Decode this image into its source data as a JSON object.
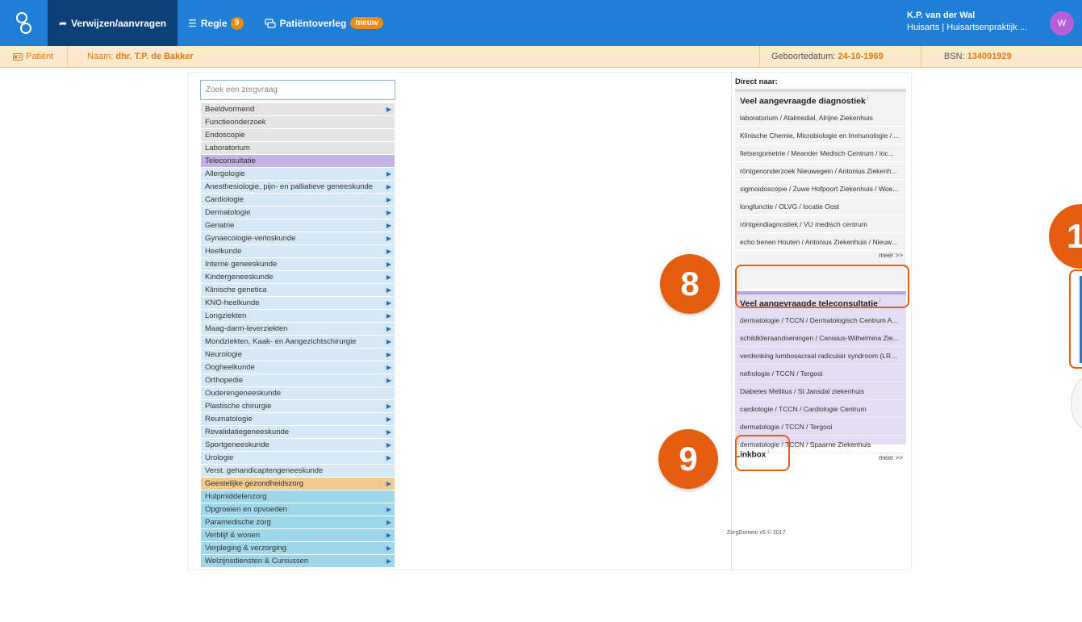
{
  "nav": {
    "items": [
      {
        "label": "Verwijzen/aanvragen",
        "icon": "share-arrow-icon"
      },
      {
        "label": "Regie",
        "icon": "list-icon",
        "badge": "9"
      },
      {
        "label": "Patiëntoverleg",
        "icon": "chat-icon",
        "badge": "nieuw"
      }
    ]
  },
  "user": {
    "name": "K.P. van der Wal",
    "role": "Huisarts | Huisartsenpraktijk ...",
    "avatar_initial": "W"
  },
  "patient": {
    "tab_label": "Patiënt",
    "name_label": "Naam:",
    "name": "dhr. T.P. de Bakker",
    "dob_label": "Geboortedatum:",
    "dob": "24-10-1969",
    "bsn_label": "BSN:",
    "bsn": "134091929"
  },
  "search": {
    "placeholder": "Zoek een zorgvraag"
  },
  "categories": [
    {
      "label": "Beeldvormend",
      "color": "gray",
      "arrow": true
    },
    {
      "label": "Functieonderzoek",
      "color": "gray",
      "arrow": false
    },
    {
      "label": "Endoscopie",
      "color": "gray",
      "arrow": false
    },
    {
      "label": "Laboratorium",
      "color": "gray",
      "arrow": false
    },
    {
      "label": "Teleconsultatie",
      "color": "purple",
      "arrow": false
    },
    {
      "label": "Allergologie",
      "color": "blue",
      "arrow": true
    },
    {
      "label": "Anesthesiologie, pijn- en palliatieve geneeskunde",
      "color": "blue",
      "arrow": true
    },
    {
      "label": "Cardiologie",
      "color": "blue",
      "arrow": true
    },
    {
      "label": "Dermatologie",
      "color": "blue",
      "arrow": true
    },
    {
      "label": "Geriatrie",
      "color": "blue",
      "arrow": true
    },
    {
      "label": "Gynaecologie-verloskunde",
      "color": "blue",
      "arrow": true
    },
    {
      "label": "Heelkunde",
      "color": "blue",
      "arrow": true
    },
    {
      "label": "Interne geneeskunde",
      "color": "blue",
      "arrow": true
    },
    {
      "label": "Kindergeneeskunde",
      "color": "blue",
      "arrow": true
    },
    {
      "label": "Klinische genetica",
      "color": "blue",
      "arrow": true
    },
    {
      "label": "KNO-heelkunde",
      "color": "blue",
      "arrow": true
    },
    {
      "label": "Longziekten",
      "color": "blue",
      "arrow": true
    },
    {
      "label": "Maag-darm-leverziekten",
      "color": "blue",
      "arrow": true
    },
    {
      "label": "Mondziekten, Kaak- en Aangezichtschirurgie",
      "color": "blue",
      "arrow": true
    },
    {
      "label": "Neurologie",
      "color": "blue",
      "arrow": true
    },
    {
      "label": "Oogheelkunde",
      "color": "blue",
      "arrow": true
    },
    {
      "label": "Orthopedie",
      "color": "blue",
      "arrow": true
    },
    {
      "label": "Ouderengeneeskunde",
      "color": "blue",
      "arrow": false
    },
    {
      "label": "Plastische chirurgie",
      "color": "blue",
      "arrow": true
    },
    {
      "label": "Reumatologie",
      "color": "blue",
      "arrow": true
    },
    {
      "label": "Revalidatiegeneeskunde",
      "color": "blue",
      "arrow": true
    },
    {
      "label": "Sportgeneeskunde",
      "color": "blue",
      "arrow": true
    },
    {
      "label": "Urologie",
      "color": "blue",
      "arrow": true
    },
    {
      "label": "Verst. gehandicaptengeneeskunde",
      "color": "blue",
      "arrow": false
    },
    {
      "label": "Geestelijke gezondheidszorg",
      "color": "orange",
      "arrow": true
    },
    {
      "label": "Hulpmiddelenzorg",
      "color": "cyan",
      "arrow": false
    },
    {
      "label": "Opgroeien en opvoeden",
      "color": "cyan",
      "arrow": true
    },
    {
      "label": "Paramedische zorg",
      "color": "cyan",
      "arrow": true
    },
    {
      "label": "Verblijf & wonen",
      "color": "cyan",
      "arrow": true
    },
    {
      "label": "Verpleging & verzorging",
      "color": "cyan",
      "arrow": true
    },
    {
      "label": "Welzijnsdiensten & Cursussen",
      "color": "cyan",
      "arrow": true
    }
  ],
  "sidebar": {
    "direct_label": "Direct naar:",
    "diagnostics": {
      "title": "Veel aangevraagde diagnostiek",
      "info_marker": "i",
      "items": [
        "laboratorium / Atalmedial, Alrijne Ziekenhuis",
        "Klinische Chemie, Microbiologie en Immunologie / ...",
        "fietsergometrie / Meander Medisch Centrum / loc...",
        "röntgenonderzoek Nieuwegein / Antonius Ziekenh...",
        "sigmoidoscopie / Zuwe Hofpoort Ziekenhuis / Woe...",
        "longfunctie / OLVG / locatie Oost",
        "röntgendiagnostiek / VU medisch centrum",
        "echo benen Houten / Antonius Ziekenhuis / Nieuw..."
      ],
      "more": "meer >>"
    },
    "teleconsult": {
      "title": "Veel aangevraagde teleconsultatie",
      "info_marker": "i",
      "items": [
        "dermatologie / TCCN / Dermatologisch Centrum A...",
        "schildklieraandoeningen / Canisius-Wilhelmina Zie...",
        "verdenking lumbosacraal radiculair syndroom (LRS)...",
        "nefrologie / TCCN / Tergooi",
        "Diabetes Mellitus / St Jansdal ziekenhuis",
        "cardiologie / TCCN / Cardiologie Centrum",
        "dermatologie / TCCN / Tergooi",
        "dermatologie / TCCN / Spaarne Ziekenhuis"
      ],
      "more": "meer >>"
    },
    "linkbox": "Linkbox",
    "linkbox_info": "i",
    "footer": "ZorgDomein v5 © 2017"
  },
  "callouts": {
    "c8": "8",
    "c9": "9",
    "c1": "1"
  },
  "colors": {
    "nav_bg": "#1f7fd6",
    "nav_active": "#0e3f78",
    "accent_orange": "#e55e10",
    "patient_bar": "#fde9cc"
  }
}
